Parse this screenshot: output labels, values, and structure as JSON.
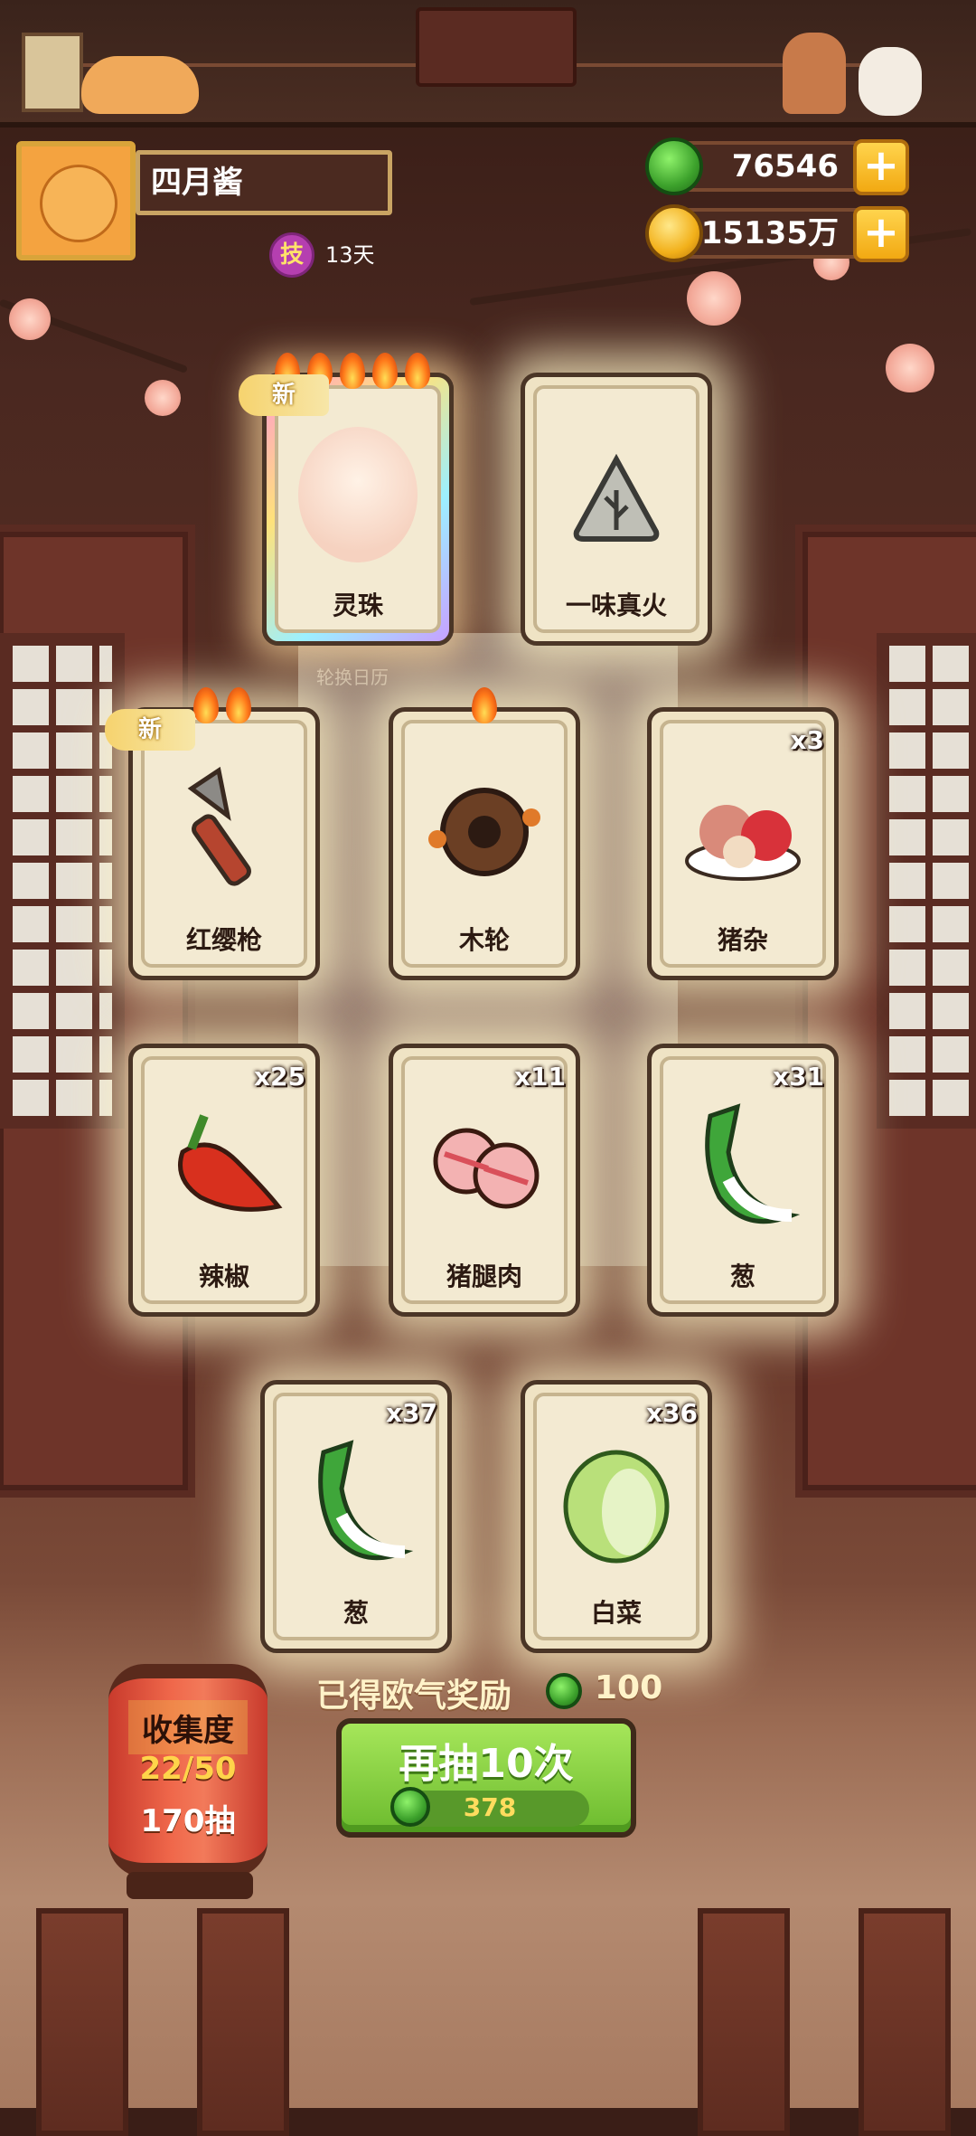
{
  "player": {
    "name": "四月酱",
    "skill_badge": "技",
    "days": "13天"
  },
  "currencies": {
    "jade": "76546",
    "coins": "15135万"
  },
  "calendar_label": "轮换日历",
  "cards": [
    {
      "label": "灵珠",
      "count": "",
      "new": "新",
      "flames": 5
    },
    {
      "label": "一味真火",
      "count": "",
      "new": "",
      "flames": 0
    },
    {
      "label": "红缨枪",
      "count": "",
      "new": "新",
      "flames": 2
    },
    {
      "label": "木轮",
      "count": "",
      "new": "",
      "flames": 1
    },
    {
      "label": "猪杂",
      "count": "x3",
      "new": "",
      "flames": 0
    },
    {
      "label": "辣椒",
      "count": "x25",
      "new": "",
      "flames": 0
    },
    {
      "label": "猪腿肉",
      "count": "x11",
      "new": "",
      "flames": 0
    },
    {
      "label": "葱",
      "count": "x31",
      "new": "",
      "flames": 0
    },
    {
      "label": "葱",
      "count": "x37",
      "new": "",
      "flames": 0
    },
    {
      "label": "白菜",
      "count": "x36",
      "new": "",
      "flames": 0
    }
  ],
  "reward": {
    "text": "已得欧气奖励",
    "value": "100"
  },
  "draw_button": {
    "label": "再抽10次",
    "cost": "378"
  },
  "collection": {
    "title": "收集度",
    "progress": "22/50",
    "draws": "170抽"
  }
}
